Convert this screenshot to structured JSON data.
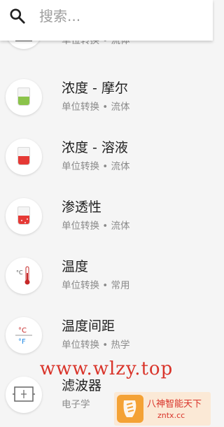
{
  "search": {
    "placeholder": "搜索..."
  },
  "rows": [
    {
      "title": "",
      "subtitle": "单位转换 • 流体",
      "icon": "partial-icon"
    },
    {
      "title": "浓度 - 摩尔",
      "subtitle": "单位转换 • 流体",
      "icon": "green-beaker-icon"
    },
    {
      "title": "浓度 - 溶液",
      "subtitle": "单位转换 • 流体",
      "icon": "red-beaker-icon"
    },
    {
      "title": "渗透性",
      "subtitle": "单位转换 • 流体",
      "icon": "red-beaker-dots-icon"
    },
    {
      "title": "温度",
      "subtitle": "单位转换 • 常用",
      "icon": "thermometer-icon"
    },
    {
      "title": "温度间距",
      "subtitle": "单位转换 • 热学",
      "icon": "celsius-fahrenheit-icon"
    },
    {
      "title": "滤波器",
      "subtitle": "电子学",
      "icon": "filter-circuit-icon"
    }
  ],
  "watermark": {
    "text": "www.wlzy.top"
  },
  "badge": {
    "title": "八神智能天下",
    "sub": "zntx.cc"
  },
  "colors": {
    "green": "#8bc34a",
    "red": "#e53935",
    "thermo": "#c62828",
    "blue": "#1e88e5"
  },
  "icons": {
    "search": "search-icon"
  }
}
